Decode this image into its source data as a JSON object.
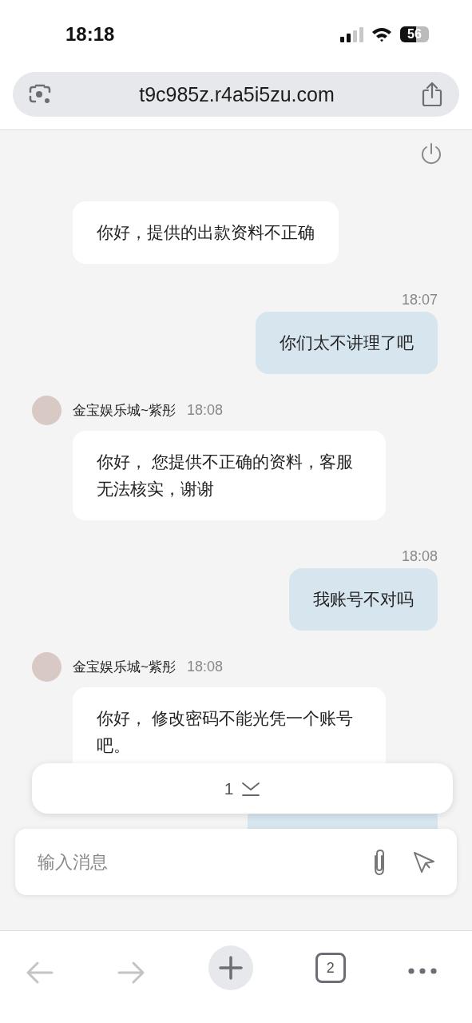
{
  "status_bar": {
    "time": "18:18",
    "battery": "56"
  },
  "address_bar": {
    "url": "t9c985z.r4a5i5zu.com"
  },
  "messages": [
    {
      "kind": "incoming",
      "text": "你好，提供的出款资料不正确"
    },
    {
      "kind": "outgoing",
      "time": "18:07",
      "text": "你们太不讲理了吧"
    },
    {
      "kind": "incoming",
      "sender": "金宝娱乐城~紫彤",
      "time": "18:08",
      "text": "你好， 您提供不正确的资料，客服无法核实，谢谢"
    },
    {
      "kind": "outgoing",
      "time": "18:08",
      "text": "我账号不对吗"
    },
    {
      "kind": "incoming",
      "sender": "金宝娱乐城~紫彤",
      "time": "18:08",
      "text": "你好， 修改密码不能光凭一个账号吧。"
    },
    {
      "kind": "outgoing"
    }
  ],
  "new_messages": {
    "count": "1"
  },
  "composer": {
    "placeholder": "输入消息"
  },
  "toolbar": {
    "back": {
      "disabled": true
    },
    "forward": {
      "disabled": true
    },
    "tab_count": "2"
  }
}
